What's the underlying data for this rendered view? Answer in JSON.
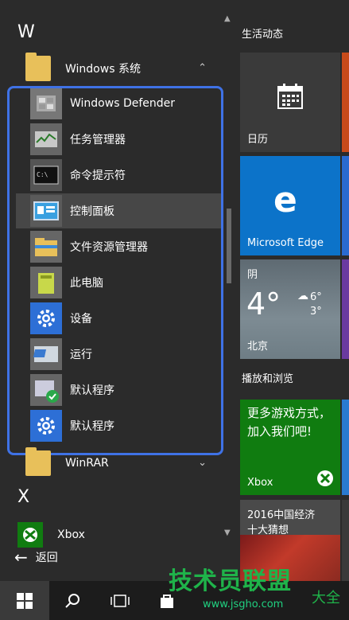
{
  "applist": {
    "letter_w": "W",
    "letter_x": "X",
    "group_windows": "Windows 系统",
    "items": [
      {
        "label": "Windows Defender"
      },
      {
        "label": "任务管理器"
      },
      {
        "label": "命令提示符"
      },
      {
        "label": "控制面板"
      },
      {
        "label": "文件资源管理器"
      },
      {
        "label": "此电脑"
      },
      {
        "label": "设备"
      },
      {
        "label": "运行"
      },
      {
        "label": "默认程序"
      },
      {
        "label": "默认程序"
      }
    ],
    "group_winrar": "WinRAR",
    "xbox": "Xbox",
    "back": "返回",
    "colors": {
      "selection_frame": "#3f72e6",
      "highlight": "#474747"
    }
  },
  "tiles": {
    "section_life": "生活动态",
    "calendar": "日历",
    "edge": "Microsoft Edge",
    "weather": {
      "condition": "阴",
      "temp": "4°",
      "high": "6°",
      "low": "3°",
      "city": "北京"
    },
    "section_play": "播放和浏览",
    "xbox_tile": {
      "text": "更多游戏方式，加入我们吧!",
      "label": "Xbox"
    },
    "news": {
      "line1": "2016中国经济",
      "line2": "十大猜想"
    }
  },
  "watermark": {
    "brand": "技术员联盟",
    "url": "www.jsgho.com",
    "suffix": "大全"
  }
}
